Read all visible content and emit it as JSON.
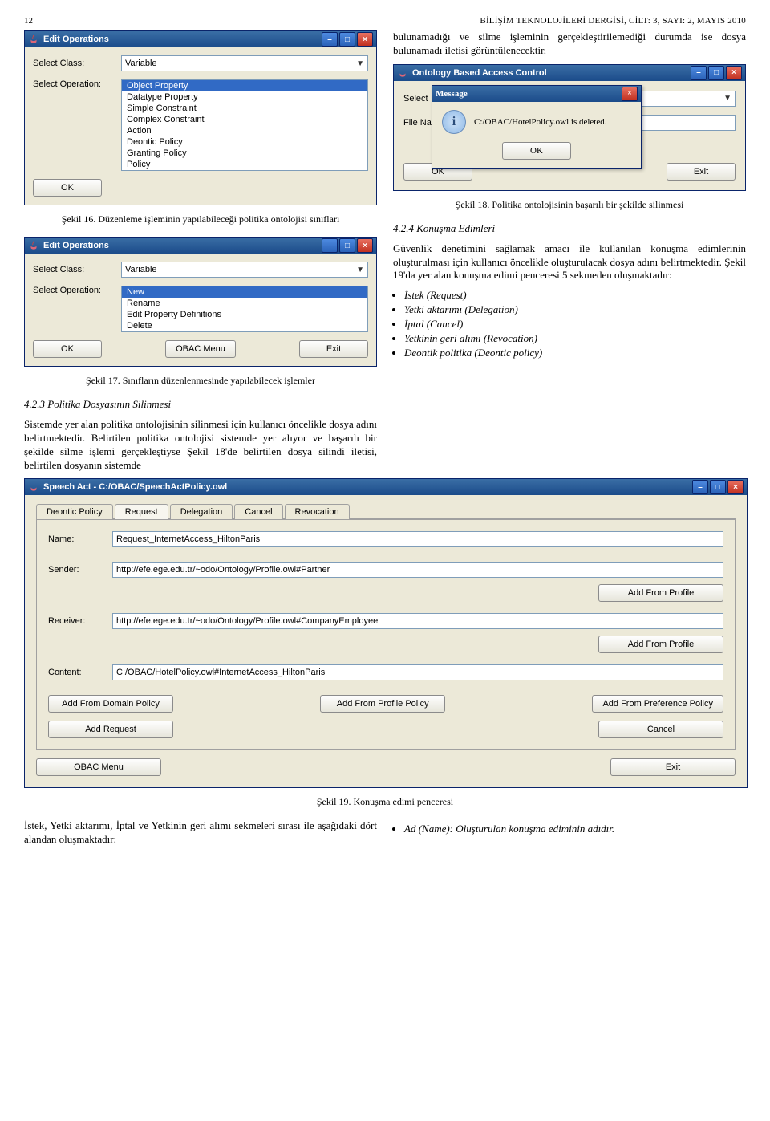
{
  "page": {
    "number": "12",
    "journal": "BİLİŞİM TEKNOLOJİLERİ DERGİSİ, CİLT: 3, SAYI: 2, MAYIS 2010"
  },
  "para_intro_right": "bulunamadığı ve silme işleminin gerçekleştirilemediği durumda ise dosya bulunamadı iletisi görüntülenecektir.",
  "editops": {
    "title": "Edit Operations",
    "select_class": "Select Class:",
    "select_op": "Select Operation:",
    "class_value": "Variable",
    "op_options1": [
      "Object Property",
      "Datatype Property",
      "Simple Constraint",
      "Complex Constraint",
      "Action",
      "Deontic Policy",
      "Granting Policy",
      "Policy"
    ],
    "op_value2": "New",
    "op_options2": [
      "New",
      "Rename",
      "Edit Property Definitions",
      "Delete"
    ],
    "ok": "OK",
    "obac_menu": "OBAC Menu",
    "exit": "Exit"
  },
  "caption16": "Şekil 16. Düzenleme işleminin yapılabileceği politika ontolojisi sınıfları",
  "caption17": "Şekil 17. Sınıfların düzenlenmesinde yapılabilecek işlemler",
  "sec423_heading": "4.2.3 Politika Dosyasının Silinmesi",
  "sec423_para": "Sistemde yer alan politika ontolojisinin silinmesi için kullanıcı öncelikle dosya adını belirtmektedir. Belirtilen politika ontolojisi sistemde yer alıyor ve başarılı bir şekilde silme işlemi gerçekleştiyse Şekil 18'de belirtilen dosya silindi iletisi, belirtilen dosyanın sistemde",
  "obac": {
    "title": "Ontology Based Access Control",
    "select_label": "Select",
    "file_label": "File Na",
    "ok": "OK",
    "exit": "Exit",
    "msg_title": "Message",
    "msg_text": "C:/OBAC/HotelPolicy.owl is deleted.",
    "msg_ok": "OK"
  },
  "caption18": "Şekil 18. Politika ontolojisinin başarılı bir şekilde silinmesi",
  "sec424_heading": "4.2.4 Konuşma Edimleri",
  "sec424_para": "Güvenlik denetimini sağlamak amacı ile kullanılan konuşma edimlerinin oluşturulması için kullanıcı öncelikle oluşturulacak dosya adını belirtmektedir. Şekil 19'da yer alan konuşma edimi penceresi 5 sekmeden oluşmaktadır:",
  "bullets": [
    "İstek (Request)",
    "Yetki aktarımı (Delegation)",
    "İptal (Cancel)",
    "Yetkinin geri alımı (Revocation)",
    "Deontik politika (Deontic policy)"
  ],
  "speech": {
    "title": "Speech Act - C:/OBAC/SpeechActPolicy.owl",
    "tabs": [
      "Deontic Policy",
      "Request",
      "Delegation",
      "Cancel",
      "Revocation"
    ],
    "active_tab": "Request",
    "labels": {
      "name": "Name:",
      "sender": "Sender:",
      "receiver": "Receiver:",
      "content": "Content:"
    },
    "values": {
      "name": "Request_InternetAccess_HiltonParis",
      "sender": "http://efe.ege.edu.tr/~odo/Ontology/Profile.owl#Partner",
      "receiver": "http://efe.ege.edu.tr/~odo/Ontology/Profile.owl#CompanyEmployee",
      "content": "C:/OBAC/HotelPolicy.owl#InternetAccess_HiltonParis"
    },
    "buttons": {
      "add_from_profile": "Add From Profile",
      "add_from_domain": "Add From Domain Policy",
      "add_from_profile_policy": "Add From Profile Policy",
      "add_from_pref": "Add From Preference Policy",
      "add_request": "Add Request",
      "cancel": "Cancel",
      "obac_menu": "OBAC Menu",
      "exit": "Exit"
    }
  },
  "caption19": "Şekil 19. Konuşma edimi penceresi",
  "bottom_left": "İstek, Yetki aktarımı, İptal ve Yetkinin geri alımı sekmeleri sırası ile aşağıdaki dört alandan oluşmaktadır:",
  "bottom_bullet_label": "Ad (Name):",
  "bottom_bullet_text": " Oluşturulan konuşma ediminin adıdır."
}
